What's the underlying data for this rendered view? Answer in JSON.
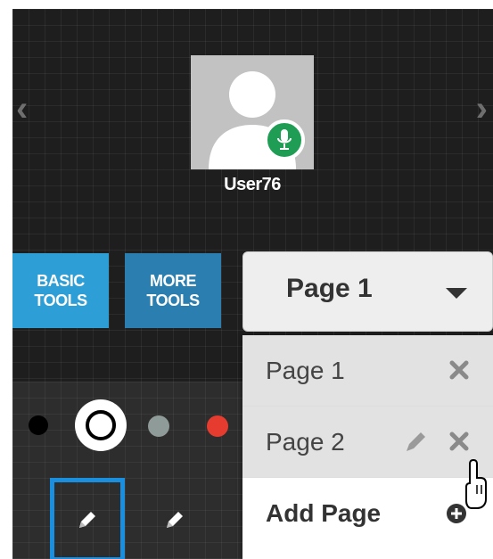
{
  "user": {
    "name": "User76",
    "mic_status": "active"
  },
  "toolbar": {
    "basic_tools_label": "BASIC TOOLS",
    "more_tools_label": "MORE TOOLS"
  },
  "page_selector": {
    "selected": "Page 1"
  },
  "page_menu": {
    "items": [
      {
        "label": "Page 1",
        "actions": [
          "close-icon"
        ]
      },
      {
        "label": "Page 2",
        "actions": [
          "pencil-icon",
          "close-icon"
        ]
      }
    ],
    "add_label": "Add Page"
  },
  "colors": {
    "palette": [
      "#000000",
      "#ffffff",
      "#8f9b98",
      "#e63c2f"
    ],
    "selected": "#ffffff",
    "accent": "#2e9ed6",
    "mic_green": "#1f9d55",
    "selection_border": "#1a8fe0"
  },
  "icons": [
    "chevron-left-icon",
    "chevron-right-icon",
    "person-icon",
    "microphone-icon",
    "caret-down-icon",
    "close-icon",
    "pencil-icon",
    "plus-circle-icon",
    "hand-cursor-icon"
  ]
}
